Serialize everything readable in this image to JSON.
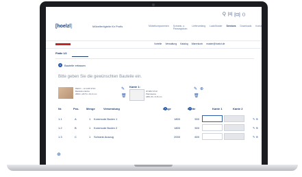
{
  "header": {
    "logo_main": "[hoelzl",
    "logo_bracket": "]",
    "tagline": "Möbelfertigteile für Profis",
    "icons": [
      "search-icon",
      "grid-icon",
      "document-icon",
      "cart-icon"
    ],
    "icon_glyphs": [
      "Q",
      "|≡|",
      "[⊡]",
      "⟨⟩"
    ],
    "nav": [
      "Möbelkomponenten",
      "Schrank- u. Planungskom.",
      "Lieferumfang",
      "Lack/Muster",
      "Services",
      "Downloads",
      "Kontakt"
    ],
    "nav_active": "Services"
  },
  "subbar": {
    "links": [
      "Vorteile",
      "Verwaltung",
      "Katalog",
      "Warenkorb",
      "muster@hoelzl.de"
    ]
  },
  "tabs": [
    "Platte 1/2",
    ""
  ],
  "step": {
    "number": "1",
    "label": "Bauteile erfassen",
    "instruction": "Bitte geben Sie die gewünschten Bauteile ein."
  },
  "material": {
    "lines": [
      "DEKO – H 1145 ST10",
      "Bardolino Eiche",
      "2800 x 2070 x 19,0 mm"
    ]
  },
  "edge": {
    "title": "Kante 1:",
    "lines": [
      "W 980 ST10",
      "Platinweiss",
      "ABS 23 x 0,8 mm"
    ]
  },
  "table": {
    "headers": [
      "Nr.",
      "Pos.",
      "Menge",
      "Verwendung",
      "Länge",
      "Breite",
      "Kante 1",
      "Kante 2"
    ],
    "rows": [
      {
        "nr": "1.1",
        "pos": "A",
        "menge": "1",
        "verwendung": "Kommode Boden 1",
        "laenge": "1800",
        "breite": "500"
      },
      {
        "nr": "1.2",
        "pos": "B",
        "menge": "1",
        "verwendung": "Kommode Boden 2",
        "laenge": "1800",
        "breite": "500"
      },
      {
        "nr": "1.3",
        "pos": "C",
        "menge": "1",
        "verwendung": "Schrank Auszug",
        "laenge": "2000",
        "breite": "600"
      }
    ],
    "row_action_glyph": "✎ ⊕"
  }
}
